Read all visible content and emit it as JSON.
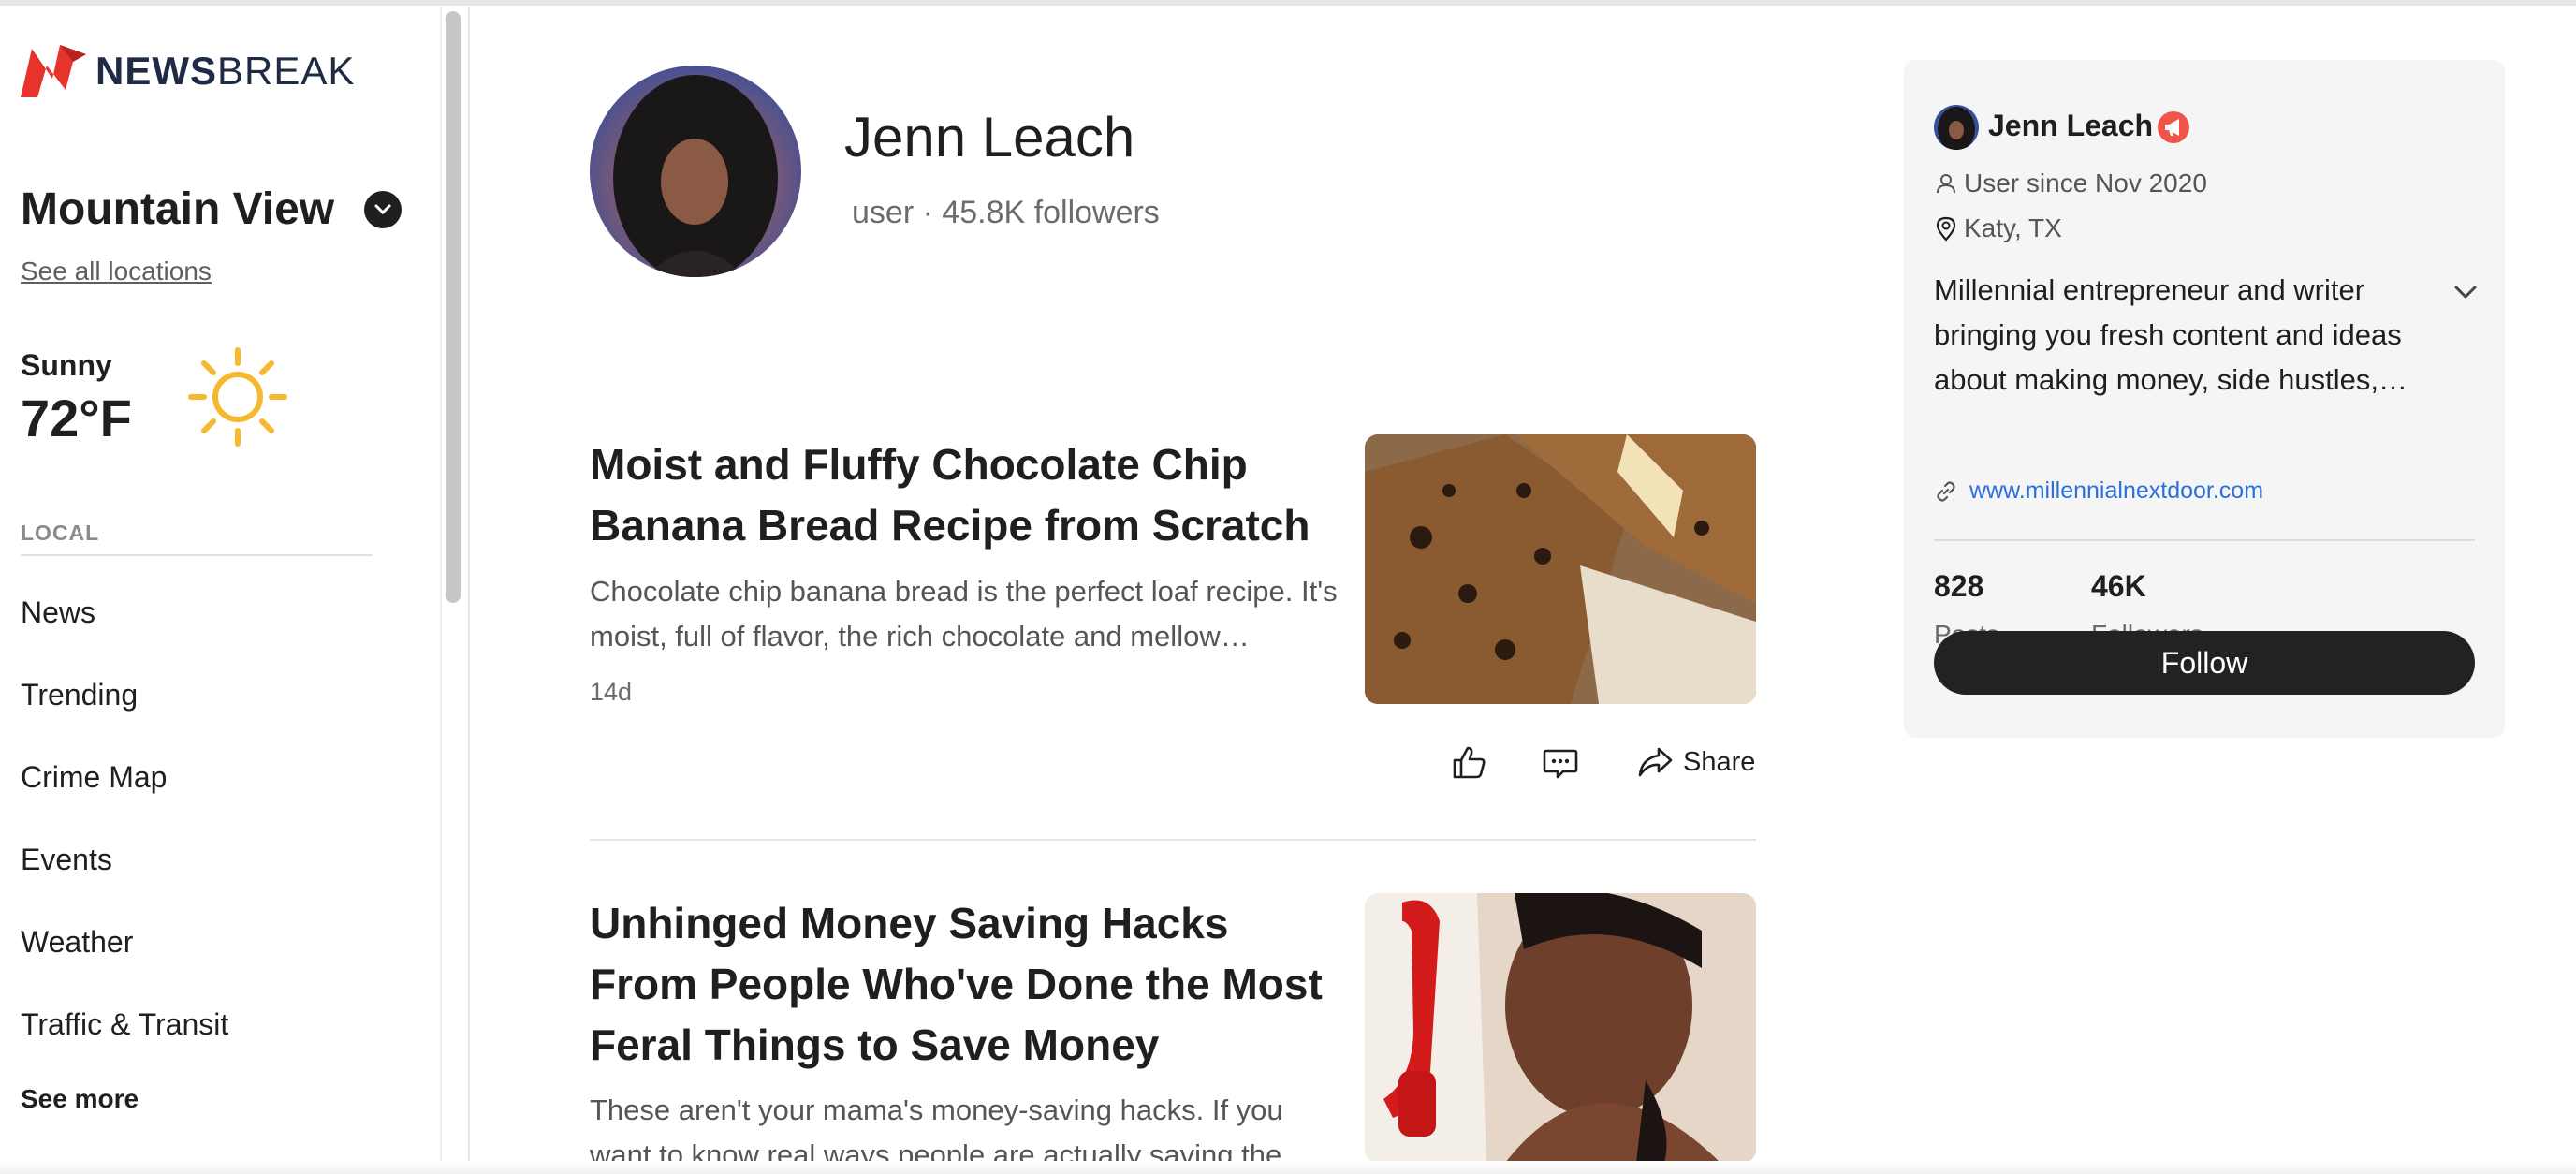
{
  "brand": {
    "logo_bold": "NEWS",
    "logo_light": "BREAK",
    "brand_color": "#e8322c"
  },
  "sidebar": {
    "location": "Mountain View",
    "see_all_locations": "See all locations",
    "weather": {
      "condition": "Sunny",
      "temp": "72°F",
      "icon": "sun-icon"
    },
    "section_header": "LOCAL",
    "items": [
      {
        "label": "News"
      },
      {
        "label": "Trending"
      },
      {
        "label": "Crime Map"
      },
      {
        "label": "Events"
      },
      {
        "label": "Weather"
      },
      {
        "label": "Traffic & Transit"
      }
    ],
    "see_more": "See more"
  },
  "profile": {
    "name": "Jenn Leach",
    "meta": "user · 45.8K followers"
  },
  "articles": [
    {
      "title": "Moist and Fluffy Chocolate Chip Banana Bread Recipe from Scratch",
      "snippet": "Chocolate chip banana bread is the perfect loaf recipe. It's moist, full of flavor, the rich chocolate and mellow…",
      "age": "14d",
      "share_label": "Share"
    },
    {
      "title": "Unhinged Money Saving Hacks From People Who've Done the Most Feral Things to Save Money",
      "snippet": "These aren't your mama's money-saving hacks. If you want to know real ways people are actually saving the…"
    }
  ],
  "card": {
    "name": "Jenn Leach",
    "user_since": "User since Nov 2020",
    "location": "Katy, TX",
    "bio": "Millennial entrepreneur and writer bringing you fresh content and ideas about making money, side hustles,…",
    "website": "www.millennialnextdoor.com",
    "stats": [
      {
        "value": "828",
        "label": "Posts"
      },
      {
        "value": "46K",
        "label": "Followers"
      }
    ],
    "follow_label": "Follow",
    "link_color": "#2a6fdb",
    "button_color": "#222222"
  }
}
